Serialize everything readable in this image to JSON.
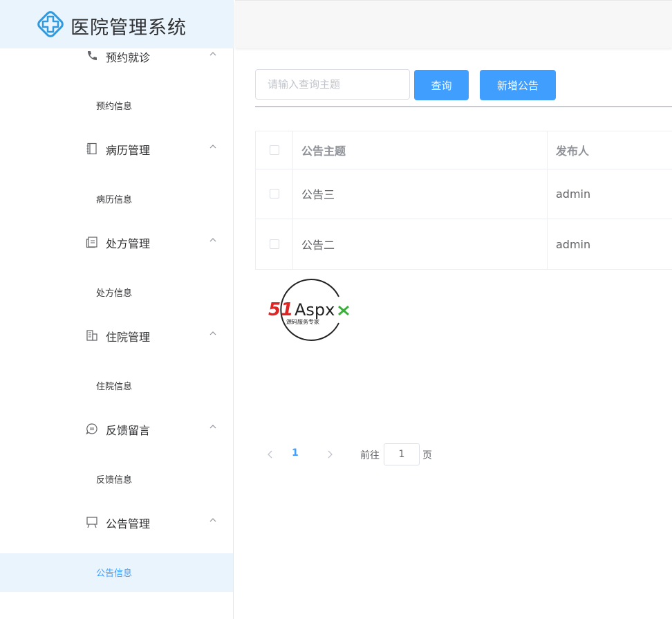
{
  "app": {
    "title": "医院管理系统",
    "brand_color": "#409eff"
  },
  "sidebar": {
    "groups": [
      {
        "label": "预约就诊",
        "icon": "phone-icon",
        "sub": "预约信息"
      },
      {
        "label": "病历管理",
        "icon": "notebook-icon",
        "sub": "病历信息"
      },
      {
        "label": "处方管理",
        "icon": "tickets-icon",
        "sub": "处方信息"
      },
      {
        "label": "住院管理",
        "icon": "office-building-icon",
        "sub": "住院信息"
      },
      {
        "label": "反馈留言",
        "icon": "chat-icon",
        "sub": "反馈信息"
      },
      {
        "label": "公告管理",
        "icon": "easel-icon",
        "sub": "公告信息"
      }
    ],
    "active_sub": "公告信息"
  },
  "toolbar": {
    "search_placeholder": "请输入查询主题",
    "search_value": "",
    "query_label": "查询",
    "add_label": "新增公告"
  },
  "table": {
    "columns": [
      "公告主题",
      "发布人"
    ],
    "rows": [
      {
        "topic": "公告三",
        "publisher": "admin"
      },
      {
        "topic": "公告二",
        "publisher": "admin"
      }
    ]
  },
  "watermark": {
    "text": "51Aspx",
    "subtext": "源码服务专家"
  },
  "pagination": {
    "current_page": "1",
    "goto_label": "前往",
    "goto_value": "1",
    "page_unit": "页"
  }
}
